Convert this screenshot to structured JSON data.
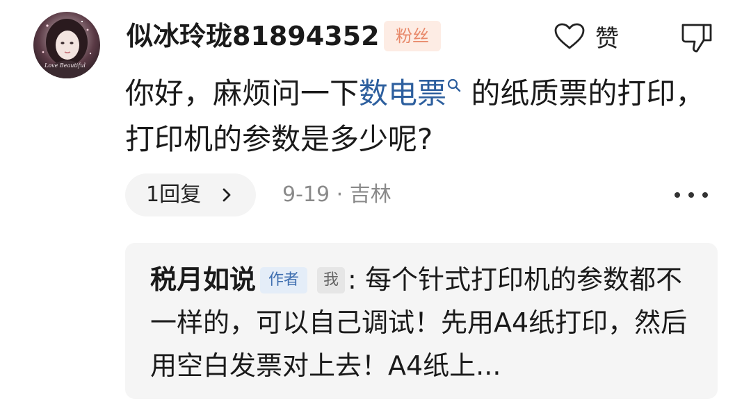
{
  "comment": {
    "username": "似冰玲珑81894352",
    "fan_badge": "粉丝",
    "like_label": "赞",
    "content_before": "你好，麻烦问一下",
    "topic_link": "数电票",
    "content_after": " 的纸质票的打印，打印机的参数是多少呢?",
    "reply_count": "1回复",
    "date": "9-19",
    "separator": "·",
    "location": "吉林",
    "avatar_overlay_text": "Love Beautiful"
  },
  "sub_reply": {
    "author": "税月如说",
    "author_tag": "作者",
    "me_tag": "我",
    "colon": ":",
    "text": " 每个针式打印机的参数都不一样的，可以自己调试！先用A4纸打印，然后用空白发票对上去！A4纸上..."
  },
  "icons": {
    "like": "heart-outline-icon",
    "dislike": "thumbs-down-outline-icon",
    "topic_search": "search-icon",
    "reply_chevron": "chevron-right-icon",
    "more": "more-dots-icon"
  },
  "colors": {
    "link": "#2d5f9e",
    "fan_badge_bg": "#fdece4",
    "fan_badge_text": "#e8896a",
    "author_tag_bg": "#e4edf8",
    "author_tag_text": "#3f6fb0",
    "meta_text": "#8a8a8a",
    "sub_reply_bg": "#f5f5f5"
  }
}
